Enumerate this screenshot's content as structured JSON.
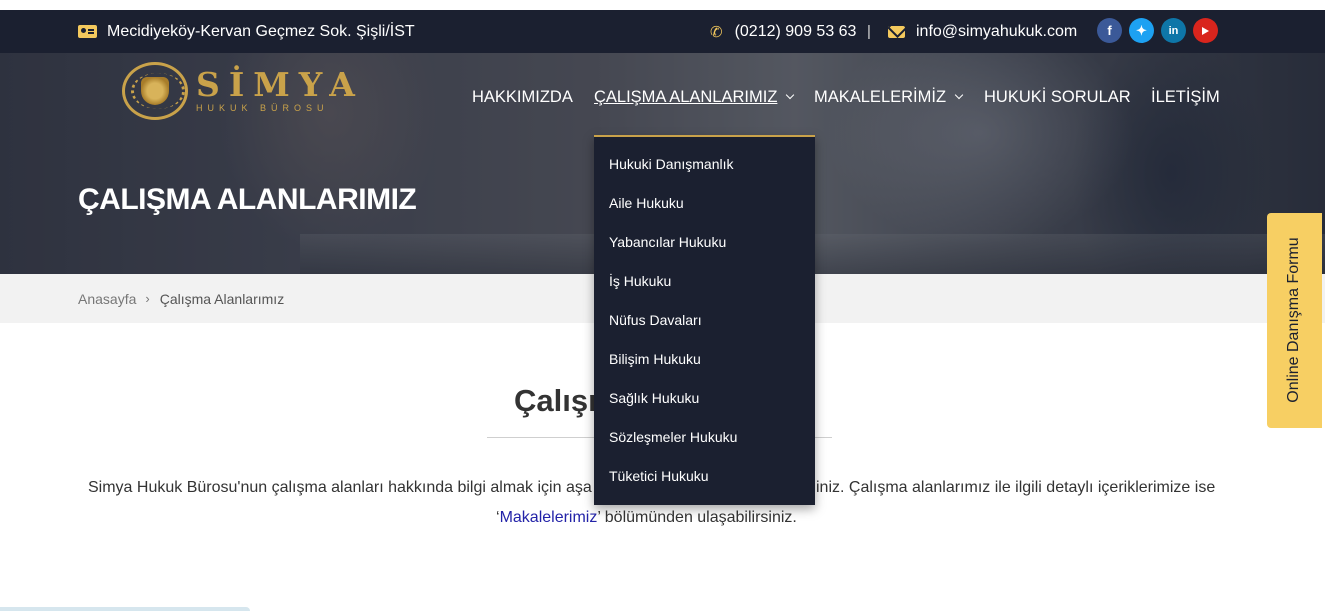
{
  "topbar": {
    "address": "Mecidiyeköy-Kervan Geçmez Sok. Şişli/İST",
    "phone": "(0212) 909 53 63",
    "separator": "|",
    "email": "info@simyahukuk.com",
    "social": [
      "facebook-icon",
      "twitter-icon",
      "linkedin-icon",
      "youtube-icon"
    ]
  },
  "logo": {
    "name": "SİMYA",
    "sub": "HUKUK BÜROSU"
  },
  "nav": [
    {
      "label": "HAKKIMIZDA"
    },
    {
      "label": "ÇALIŞMA ALANLARIMIZ"
    },
    {
      "label": "MAKALELERİMİZ"
    },
    {
      "label": "HUKUKİ SORULAR"
    },
    {
      "label": "İLETİŞİM"
    }
  ],
  "dropdown": [
    {
      "label": "Hukuki Danışmanlık"
    },
    {
      "label": "Aile Hukuku"
    },
    {
      "label": "Yabancılar Hukuku"
    },
    {
      "label": "İş Hukuku"
    },
    {
      "label": "Nüfus Davaları"
    },
    {
      "label": "Bilişim Hukuku"
    },
    {
      "label": "Sağlık Hukuku"
    },
    {
      "label": "Sözleşmeler Hukuku"
    },
    {
      "label": "Tüketici Hukuku"
    }
  ],
  "hero": {
    "title": "ÇALIŞMA ALANLARIMIZ"
  },
  "breadcrumb": {
    "home": "Anasayfa",
    "arrow": "›",
    "current": "Çalışma Alanlarımız"
  },
  "content": {
    "title_visible": "Çalışm",
    "para1_left": "Simya Hukuk Bürosu'nun çalışma alanları hakkında bilgi almak için aşa",
    "para1_right": "iniz. Çalışma alanlarımız ile ilgili detaylı içeriklerimize ise",
    "para2_open": "‘",
    "para2_link": "Makalelerimiz",
    "para2_rest": "’ bölümünden ulaşabilirsiniz."
  },
  "side_tab": {
    "label": "Online Danışma Formu"
  },
  "colors": {
    "dark": "#1b2030",
    "gold": "#c9a24a",
    "tab": "#f7cf63",
    "link": "#2323a8"
  }
}
